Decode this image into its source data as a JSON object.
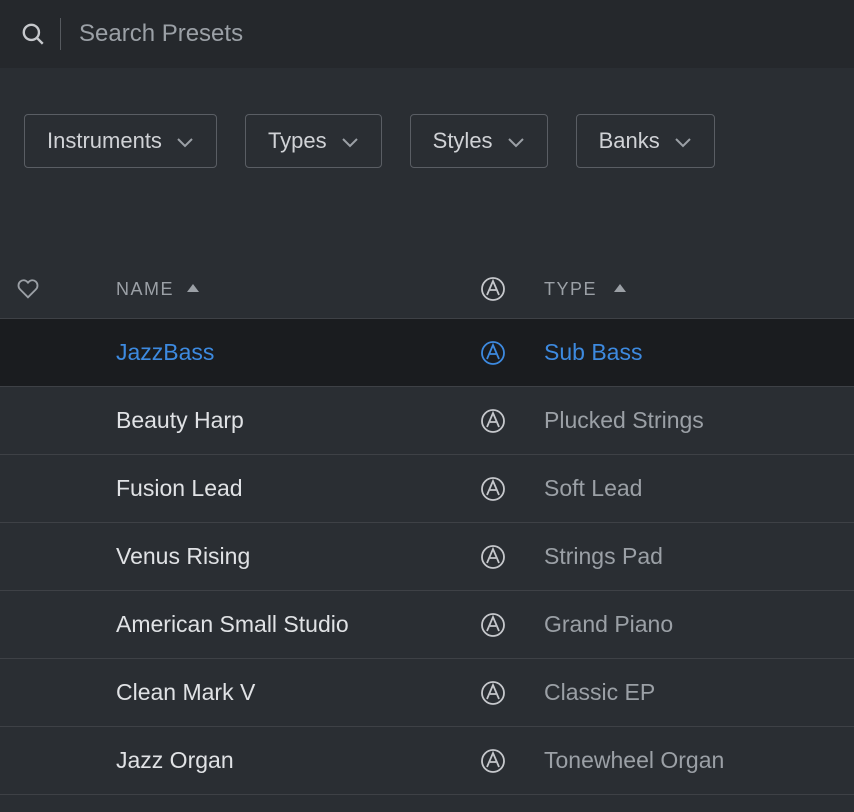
{
  "search": {
    "placeholder": "Search Presets",
    "value": ""
  },
  "filters": [
    {
      "label": "Instruments"
    },
    {
      "label": "Types"
    },
    {
      "label": "Styles"
    },
    {
      "label": "Banks"
    }
  ],
  "table": {
    "headers": {
      "name": "NAME",
      "type": "TYPE"
    },
    "rows": [
      {
        "name": "JazzBass",
        "type": "Sub Bass",
        "selected": true
      },
      {
        "name": "Beauty Harp",
        "type": "Plucked Strings",
        "selected": false
      },
      {
        "name": "Fusion Lead",
        "type": "Soft Lead",
        "selected": false
      },
      {
        "name": "Venus Rising",
        "type": "Strings Pad",
        "selected": false
      },
      {
        "name": "American Small Studio",
        "type": "Grand Piano",
        "selected": false
      },
      {
        "name": "Clean Mark V",
        "type": "Classic EP",
        "selected": false
      },
      {
        "name": "Jazz Organ",
        "type": "Tonewheel Organ",
        "selected": false
      }
    ]
  }
}
